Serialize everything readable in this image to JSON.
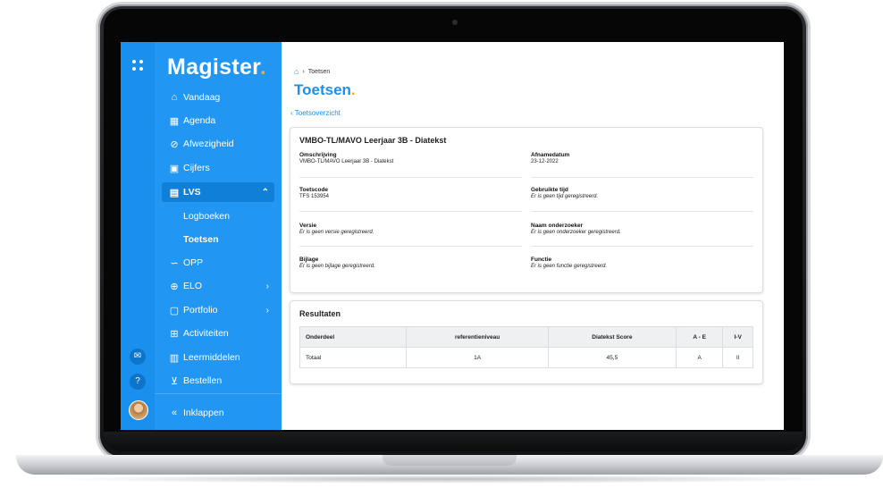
{
  "app": {
    "logo_text": "Magister",
    "logo_dot": ".",
    "accent": "#1a90ee",
    "sidebar_color": "#2196f3",
    "dot_color": "#f5a623"
  },
  "rail": {
    "icons": [
      "apps-grid-icon",
      "mail-icon",
      "help-icon",
      "avatar"
    ]
  },
  "sidebar": {
    "items": [
      {
        "label": "Vandaag",
        "icon": "home-icon"
      },
      {
        "label": "Agenda",
        "icon": "calendar-icon"
      },
      {
        "label": "Afwezigheid",
        "icon": "check-circle-icon"
      },
      {
        "label": "Cijfers",
        "icon": "grades-icon"
      },
      {
        "label": "LVS",
        "icon": "student-card-icon",
        "expanded": true
      },
      {
        "label": "Logboeken"
      },
      {
        "label": "Toetsen",
        "selected": true
      },
      {
        "label": "OPP",
        "icon": "opp-icon"
      },
      {
        "label": "ELO",
        "icon": "elo-icon"
      },
      {
        "label": "Portfolio",
        "icon": "portfolio-icon"
      },
      {
        "label": "Activiteiten",
        "icon": "activity-icon"
      },
      {
        "label": "Leermiddelen",
        "icon": "books-icon"
      },
      {
        "label": "Bestellen",
        "icon": "cart-icon"
      }
    ],
    "collapse_label": "Inklappen"
  },
  "breadcrumb": {
    "current": "Toetsen"
  },
  "page": {
    "title": "Toetsen",
    "title_dot": ".",
    "back_label": "Toetsoverzicht"
  },
  "details": {
    "title": "VMBO-TL/MAVO Leerjaar 3B - Diatekst",
    "fields": [
      {
        "label": "Omschrijving",
        "value": "VMBO-TL/MAVO Leerjaar 3B - Diatekst"
      },
      {
        "label": "Afnamedatum",
        "value": "23-12-2022"
      },
      {
        "label": "Toetscode",
        "value": "TFS 153954"
      },
      {
        "label": "Gebruikte tijd",
        "value": "Er is geen tijd geregistreerd."
      },
      {
        "label": "Versie",
        "value": "Er is geen versie geregistreerd."
      },
      {
        "label": "Naam onderzoeker",
        "value": "Er is geen onderzoeker geregistreerd."
      },
      {
        "label": "Bijlage",
        "value": "Er is geen bijlage geregistreerd."
      },
      {
        "label": "Functie",
        "value": "Er is geen functie geregistreerd."
      }
    ]
  },
  "results": {
    "title": "Resultaten",
    "headers": [
      "Onderdeel",
      "referentieniveau",
      "Diatekst Score",
      "A - E",
      "I-V"
    ],
    "rows": [
      [
        "Totaal",
        "1A",
        "45,5",
        "A",
        "II"
      ]
    ]
  }
}
